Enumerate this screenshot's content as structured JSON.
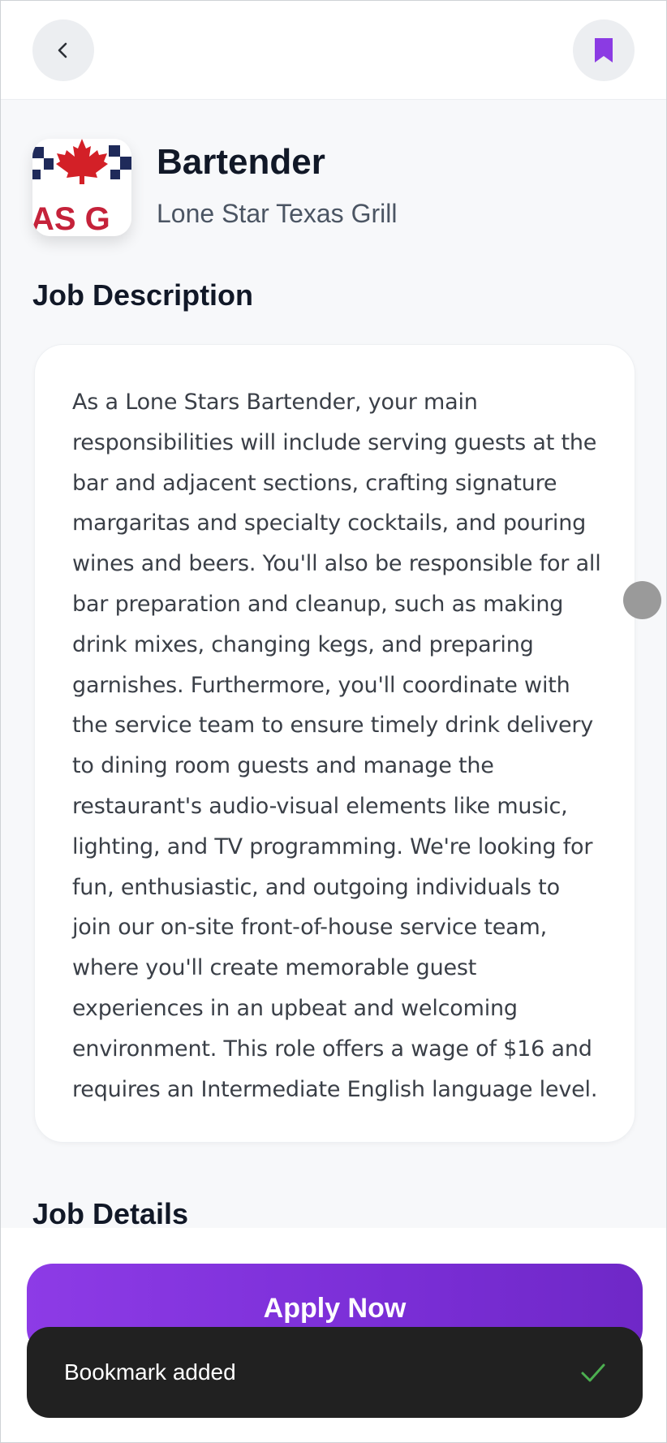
{
  "header": {
    "back_icon": "chevron-left-icon",
    "bookmark_icon": "bookmark-icon",
    "accent_color": "#8b3be3"
  },
  "job": {
    "title": "Bartender",
    "company": "Lone Star Texas Grill",
    "logo_text": "AS G"
  },
  "sections": {
    "description_title": "Job Description",
    "details_title": "Job Details"
  },
  "description": "As a Lone Stars Bartender, your main responsibilities will include serving guests at the bar and adjacent sections, crafting signature margaritas and specialty cocktails, and pouring wines and beers. You'll also be responsible for all bar preparation and cleanup, such as making drink mixes, changing kegs, and preparing garnishes. Furthermore, you'll coordinate with the service team to ensure timely drink delivery to dining room guests and manage the restaurant's audio-visual elements like music, lighting, and TV programming. We're looking for fun, enthusiastic, and outgoing individuals to join our on-site front-of-house service team, where you'll create memorable guest experiences in an upbeat and welcoming environment. This role offers a wage of $16 and requires an Intermediate English language level.",
  "actions": {
    "apply_label": "Apply Now"
  },
  "toast": {
    "message": "Bookmark added",
    "icon": "check-icon",
    "icon_color": "#4caf50"
  }
}
